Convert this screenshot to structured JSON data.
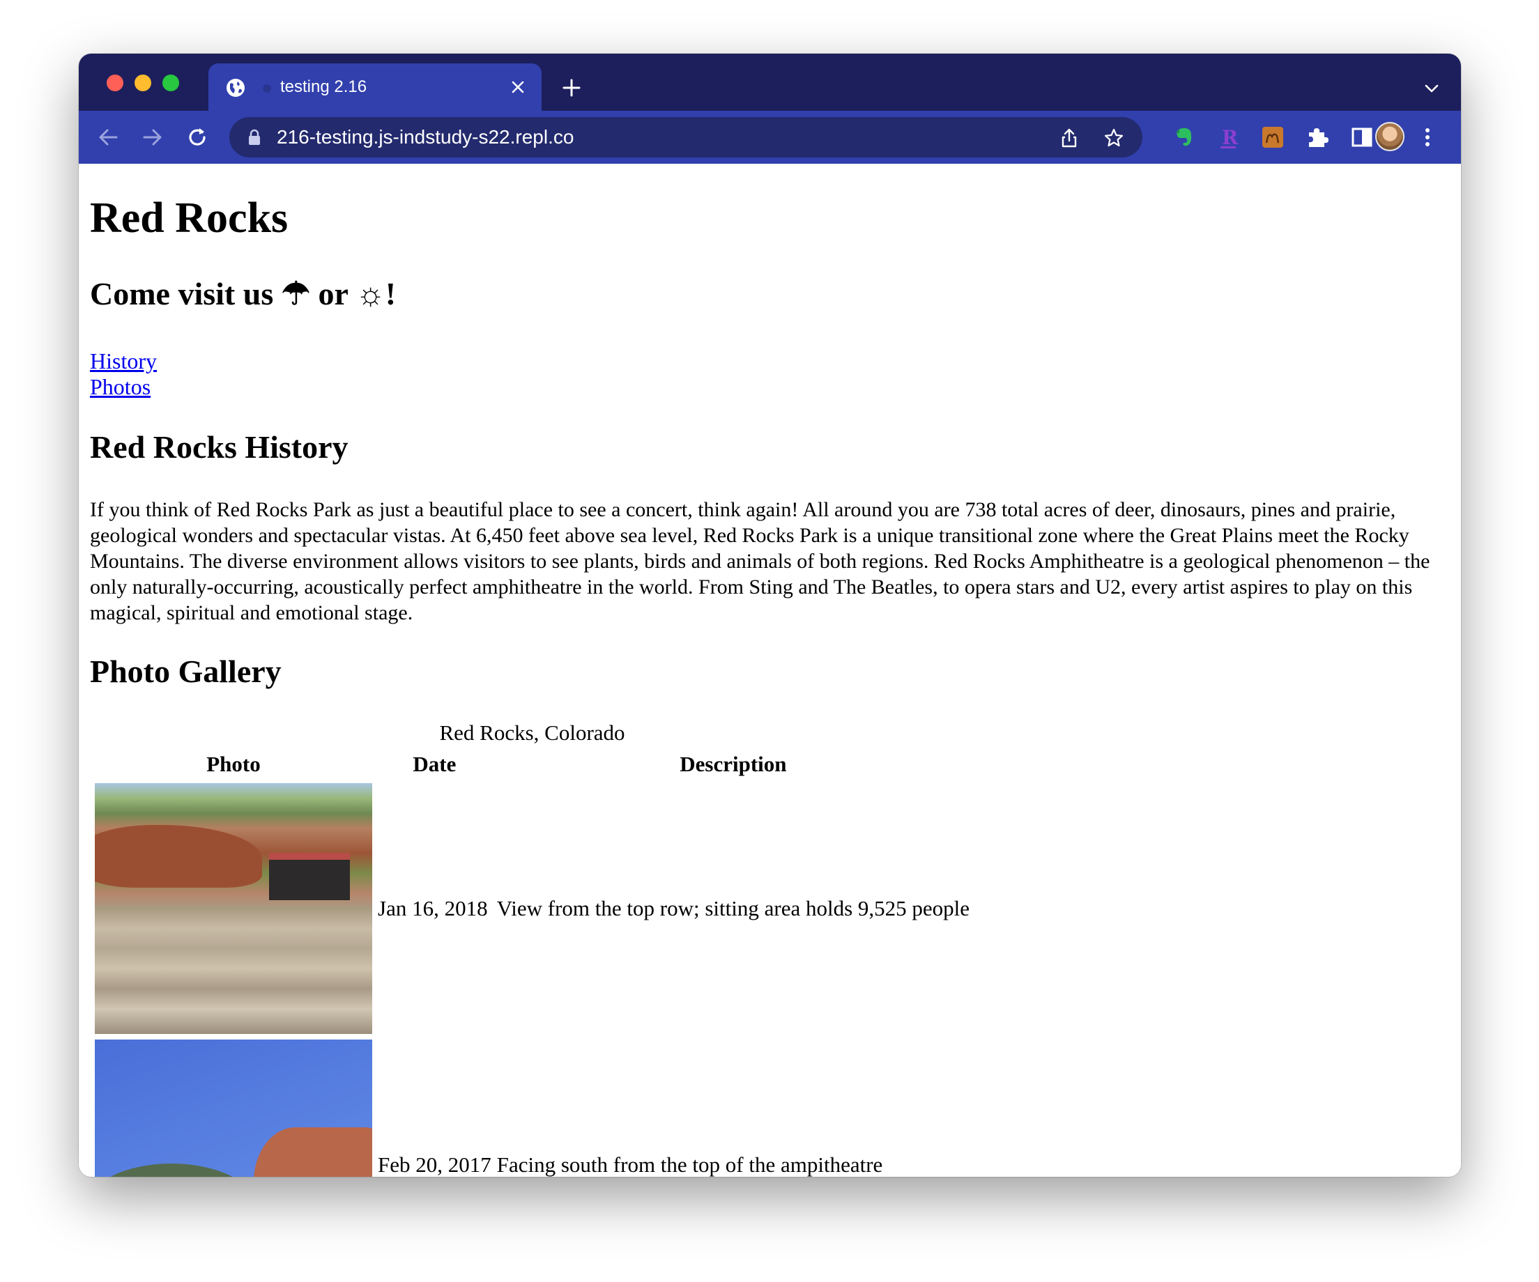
{
  "browser": {
    "tab_title": "testing 2.16",
    "url": "216-testing.js-indstudy-s22.repl.co"
  },
  "page": {
    "title": "Red Rocks",
    "subtitle": "Come visit us ☂ or ☼!",
    "nav_links": [
      "History",
      "Photos"
    ],
    "history_heading": "Red Rocks History",
    "history_text": "If you think of Red Rocks Park as just a beautiful place to see a concert, think again! All around you are 738 total acres of deer, dinosaurs, pines and prairie, geological wonders and spectacular vistas. At 6,450 feet above sea level, Red Rocks Park is a unique transitional zone where the Great Plains meet the Rocky Mountains. The diverse environment allows visitors to see plants, birds and animals of both regions. Red Rocks Amphitheatre is a geological phenomenon – the only naturally-occurring, acoustically perfect amphitheatre in the world. From Sting and The Beatles, to opera stars and U2, every artist aspires to play on this magical, spiritual and emotional stage.",
    "gallery_heading": "Photo Gallery",
    "table": {
      "caption": "Red Rocks, Colorado",
      "headers": [
        "Photo",
        "Date",
        "Description"
      ],
      "rows": [
        {
          "date": "Jan 16, 2018",
          "description": "View from the top row; sitting area holds 9,525 people"
        },
        {
          "date": "Feb 20, 2017",
          "description": "Facing south from the top of the ampitheatre"
        }
      ]
    }
  },
  "colors": {
    "tabstrip": "#1c1f5b",
    "toolbar": "#3140ad",
    "link": "#0000ee"
  },
  "icons": [
    "globe-icon",
    "close-icon",
    "plus-icon",
    "chevron-down-icon",
    "back-icon",
    "forward-icon",
    "reload-icon",
    "lock-icon",
    "share-icon",
    "star-icon",
    "evernote-icon",
    "r-extension-icon",
    "camel-extension-icon",
    "puzzle-icon",
    "side-panel-icon",
    "menu-icon"
  ]
}
